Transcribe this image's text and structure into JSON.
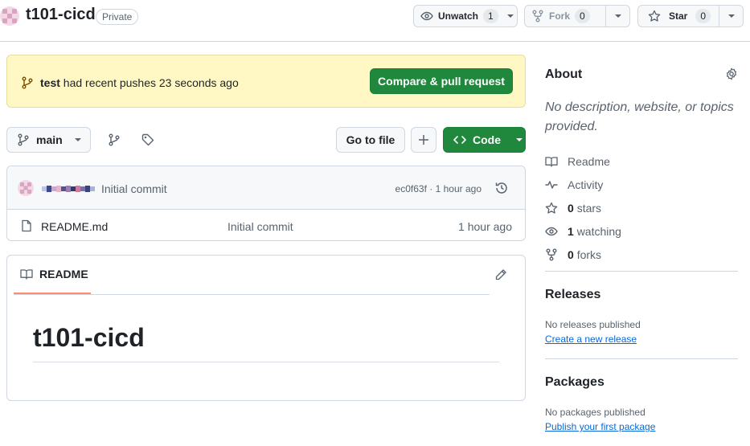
{
  "repo": {
    "name": "t101-cicd",
    "visibility": "Private"
  },
  "actions": {
    "unwatch_label": "Unwatch",
    "watch_count": "1",
    "fork_label": "Fork",
    "fork_count": "0",
    "star_label": "Star",
    "star_count": "0"
  },
  "banner": {
    "branch": "test",
    "message": "had recent pushes 23 seconds ago",
    "button_label": "Compare & pull request"
  },
  "toolbar": {
    "branch": "main",
    "goto_file_label": "Go to file",
    "code_label": "Code"
  },
  "latest_commit": {
    "message": "Initial commit",
    "hash": "ec0f63f",
    "time": "1 hour ago",
    "separator": "·"
  },
  "files": [
    {
      "name": "README.md",
      "commit_message": "Initial commit",
      "time": "1 hour ago"
    }
  ],
  "readme": {
    "tab_label": "README",
    "heading": "t101-cicd"
  },
  "sidebar": {
    "about_title": "About",
    "description": "No description, website, or topics provided.",
    "items": [
      {
        "icon": "book-icon",
        "count": "",
        "label": "Readme"
      },
      {
        "icon": "pulse-icon",
        "count": "",
        "label": "Activity"
      },
      {
        "icon": "star-icon",
        "count": "0",
        "label": "stars"
      },
      {
        "icon": "eye-icon",
        "count": "1",
        "label": "watching"
      },
      {
        "icon": "fork-icon",
        "count": "0",
        "label": "forks"
      }
    ],
    "releases_title": "Releases",
    "releases_note": "No releases published",
    "releases_link": "Create a new release",
    "packages_title": "Packages",
    "packages_note": "No packages published",
    "packages_link": "Publish your first package"
  },
  "colors": {
    "primary_green": "#1f883d",
    "banner_bg": "#fff8c5",
    "link_blue": "#0969da",
    "tab_underline": "#fd8c73"
  }
}
